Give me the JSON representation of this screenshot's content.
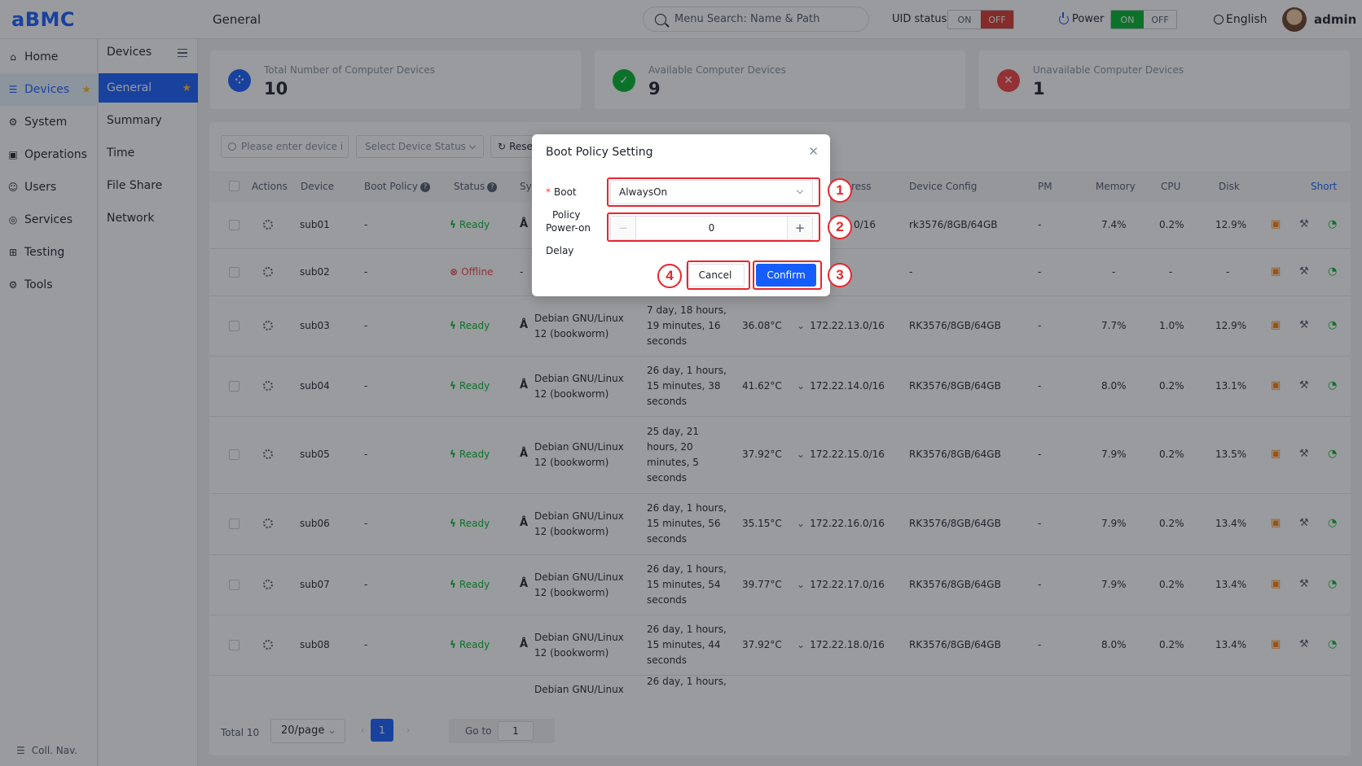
{
  "app": {
    "logo": "aBMC",
    "page_title": "General"
  },
  "header": {
    "search_placeholder": "Menu Search: Name & Path",
    "uid_status_label": "UID status",
    "uid_on": "ON",
    "uid_off": "OFF",
    "power_label": "Power",
    "power_on": "ON",
    "power_off": "OFF",
    "language": "English",
    "user": "admin"
  },
  "sidebar": {
    "items": [
      {
        "label": "Home",
        "icon": "home-icon"
      },
      {
        "label": "Devices",
        "icon": "devices-icon",
        "active": true
      },
      {
        "label": "System",
        "icon": "system-icon"
      },
      {
        "label": "Operations",
        "icon": "operations-icon"
      },
      {
        "label": "Users",
        "icon": "users-icon"
      },
      {
        "label": "Services",
        "icon": "services-icon"
      },
      {
        "label": "Testing",
        "icon": "testing-icon"
      },
      {
        "label": "Tools",
        "icon": "tools-icon"
      }
    ],
    "collapse_label": "Coll. Nav."
  },
  "subnav": {
    "header": "Devices",
    "items": [
      "General",
      "Summary",
      "Time",
      "File Share",
      "Network"
    ]
  },
  "stats": [
    {
      "label": "Total Number of Computer Devices",
      "value": "10",
      "color": "#165dff"
    },
    {
      "label": "Available Computer Devices",
      "value": "9",
      "color": "#00b42a"
    },
    {
      "label": "Unavailable Computer Devices",
      "value": "1",
      "color": "#f53f3f"
    }
  ],
  "filters": {
    "device_placeholder": "Please enter device i",
    "status_placeholder": "Select Device Status",
    "reset_label": "Rese"
  },
  "table": {
    "headers": {
      "actions": "Actions",
      "device": "Device",
      "boot_policy": "Boot Policy",
      "status": "Status",
      "system": "Sy",
      "address": "ress",
      "device_config": "Device Config",
      "pm": "PM",
      "memory": "Memory",
      "cpu": "CPU",
      "disk": "Disk",
      "shortcut": "Short"
    },
    "rows": [
      {
        "device": "sub01",
        "boot": "-",
        "status": "Ready",
        "system": "",
        "uptime": "",
        "temp": "",
        "address": "0/16",
        "config": "rk3576/8GB/64GB",
        "pm": "-",
        "memory": "7.4%",
        "cpu": "0.2%",
        "disk": "12.9%"
      },
      {
        "device": "sub02",
        "boot": "-",
        "status": "Offline",
        "system": "-",
        "uptime": "",
        "temp": "",
        "address": "",
        "config": "-",
        "pm": "-",
        "memory": "-",
        "cpu": "-",
        "disk": "-"
      },
      {
        "device": "sub03",
        "boot": "-",
        "status": "Ready",
        "system": "Debian GNU/Linux 12 (bookworm)",
        "uptime": "7 day, 18 hours, 19 minutes, 16 seconds",
        "temp": "36.08°C",
        "address": "172.22.13.0/16",
        "config": "RK3576/8GB/64GB",
        "pm": "-",
        "memory": "7.7%",
        "cpu": "1.0%",
        "disk": "12.9%"
      },
      {
        "device": "sub04",
        "boot": "-",
        "status": "Ready",
        "system": "Debian GNU/Linux 12 (bookworm)",
        "uptime": "26 day, 1 hours, 15 minutes, 38 seconds",
        "temp": "41.62°C",
        "address": "172.22.14.0/16",
        "config": "RK3576/8GB/64GB",
        "pm": "-",
        "memory": "8.0%",
        "cpu": "0.2%",
        "disk": "13.1%"
      },
      {
        "device": "sub05",
        "boot": "-",
        "status": "Ready",
        "system": "Debian GNU/Linux 12 (bookworm)",
        "uptime": "25 day, 21 hours, 20 minutes, 5 seconds",
        "temp": "37.92°C",
        "address": "172.22.15.0/16",
        "config": "RK3576/8GB/64GB",
        "pm": "-",
        "memory": "7.9%",
        "cpu": "0.2%",
        "disk": "13.5%"
      },
      {
        "device": "sub06",
        "boot": "-",
        "status": "Ready",
        "system": "Debian GNU/Linux 12 (bookworm)",
        "uptime": "26 day, 1 hours, 15 minutes, 56 seconds",
        "temp": "35.15°C",
        "address": "172.22.16.0/16",
        "config": "RK3576/8GB/64GB",
        "pm": "-",
        "memory": "7.9%",
        "cpu": "0.2%",
        "disk": "13.4%"
      },
      {
        "device": "sub07",
        "boot": "-",
        "status": "Ready",
        "system": "Debian GNU/Linux 12 (bookworm)",
        "uptime": "26 day, 1 hours, 15 minutes, 54 seconds",
        "temp": "39.77°C",
        "address": "172.22.17.0/16",
        "config": "RK3576/8GB/64GB",
        "pm": "-",
        "memory": "7.9%",
        "cpu": "0.2%",
        "disk": "13.4%"
      },
      {
        "device": "sub08",
        "boot": "-",
        "status": "Ready",
        "system": "Debian GNU/Linux 12 (bookworm)",
        "uptime": "26 day, 1 hours, 15 minutes, 44 seconds",
        "temp": "37.92°C",
        "address": "172.22.18.0/16",
        "config": "RK3576/8GB/64GB",
        "pm": "-",
        "memory": "8.0%",
        "cpu": "0.2%",
        "disk": "13.4%"
      },
      {
        "device": "",
        "boot": "",
        "status": "",
        "system": "Debian GNU/Linux",
        "uptime": "26 day, 1 hours,",
        "temp": "",
        "address": "",
        "config": "",
        "pm": "",
        "memory": "",
        "cpu": "",
        "disk": ""
      }
    ]
  },
  "pagination": {
    "total": "Total 10",
    "per_page": "20/page",
    "current_page": "1",
    "goto_label": "Go to",
    "goto_value": "1"
  },
  "modal": {
    "title": "Boot Policy Setting",
    "boot_label": "Boot",
    "boot_label_2": "Policy",
    "boot_value": "AlwaysOn",
    "delay_label": "Power-on",
    "delay_label_2": "Delay",
    "delay_value": "0",
    "cancel_label": "Cancel",
    "confirm_label": "Confirm"
  },
  "annotations": [
    "1",
    "2",
    "3",
    "4"
  ],
  "colors": {
    "primary": "#165dff",
    "success": "#00b42a",
    "danger": "#f53f3f",
    "annotation": "#e8262b"
  }
}
